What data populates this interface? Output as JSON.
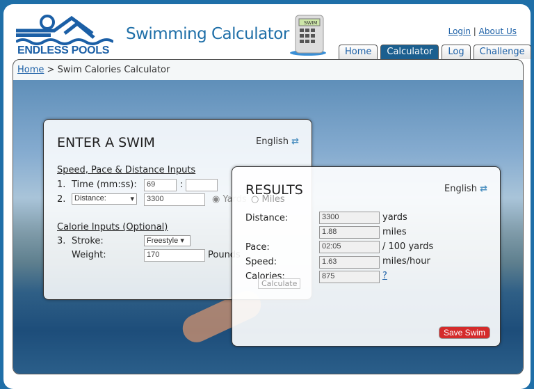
{
  "header": {
    "logo_text": "ENDLESS POOLS",
    "title": "Swimming Calculator",
    "calc_screen": "SWIM",
    "login": "Login",
    "separator": "|",
    "about": "About Us"
  },
  "tabs": [
    {
      "label": "Home"
    },
    {
      "label": "Calculator",
      "active": true
    },
    {
      "label": "Log"
    },
    {
      "label": "Challenge"
    }
  ],
  "breadcrumb": {
    "home": "Home",
    "sep": ">",
    "current": "Swim Calories Calculator"
  },
  "enter": {
    "title": "ENTER A SWIM",
    "language": "English",
    "section1": "Speed, Pace & Distance Inputs",
    "n1": "1.",
    "time_label": "Time (mm:ss):",
    "minutes": "69",
    "colon": ":",
    "seconds": "",
    "n2": "2.",
    "distance_select": "Distance:",
    "distance": "3300",
    "unit_yards": "Yards",
    "unit_miles": "Miles",
    "section2": "Calorie Inputs (Optional)",
    "n3": "3.",
    "stroke_label": "Stroke:",
    "stroke": "Freestyle",
    "weight_label": "Weight:",
    "weight": "170",
    "weight_unit": "Pounds",
    "calculate": "Calculate"
  },
  "results": {
    "title": "RESULTS",
    "language": "English",
    "distance_label": "Distance:",
    "distance_yards": "3300",
    "yards_unit": "yards",
    "distance_miles": "1.88",
    "miles_unit": "miles",
    "pace_label": "Pace:",
    "pace": "02:05",
    "pace_unit": "/ 100 yards",
    "speed_label": "Speed:",
    "speed": "1.63",
    "speed_unit": "miles/hour",
    "calories_label": "Calories:",
    "calories": "875",
    "help": "?",
    "save": "Save Swim"
  },
  "colors": {
    "brand": "#1b5fa6",
    "active_tab": "#1b5f8f",
    "save": "#d42b2b"
  }
}
